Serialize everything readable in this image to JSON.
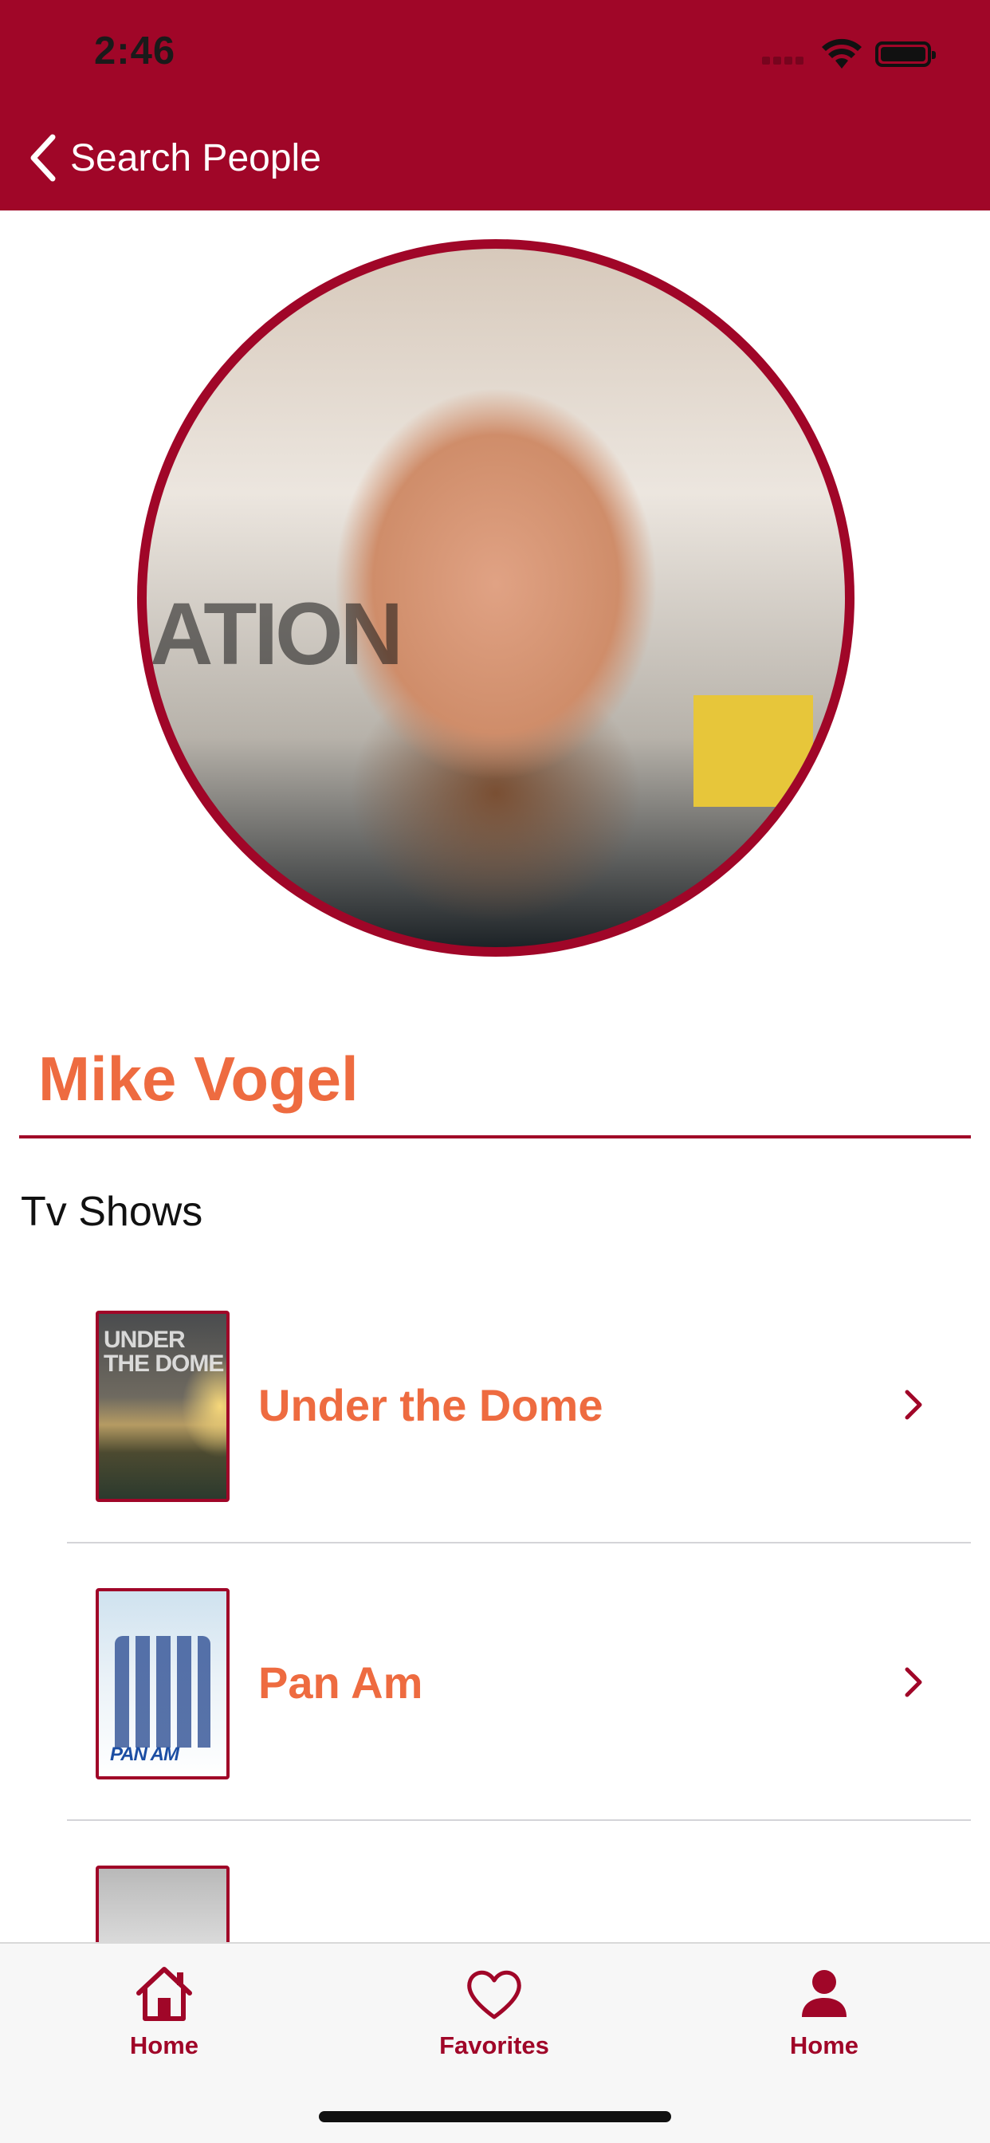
{
  "status_bar": {
    "time": "2:46"
  },
  "nav": {
    "back_label": "Search People"
  },
  "person": {
    "name": "Mike Vogel"
  },
  "photo_text": {
    "left_sign": "ATION"
  },
  "section": {
    "title": "Tv Shows"
  },
  "shows": [
    {
      "title": "Under the Dome",
      "poster_text": "UNDER THE DOME"
    },
    {
      "title": "Pan Am",
      "poster_text": "PAN AM"
    },
    {
      "title": "",
      "poster_text": ""
    }
  ],
  "tabbar": {
    "tabs": [
      {
        "label": "Home",
        "icon": "house-icon"
      },
      {
        "label": "Favorites",
        "icon": "heart-icon"
      },
      {
        "label": "Home",
        "icon": "person-icon"
      }
    ]
  },
  "colors": {
    "brand": "#A00628",
    "accent": "#EE6B40"
  }
}
